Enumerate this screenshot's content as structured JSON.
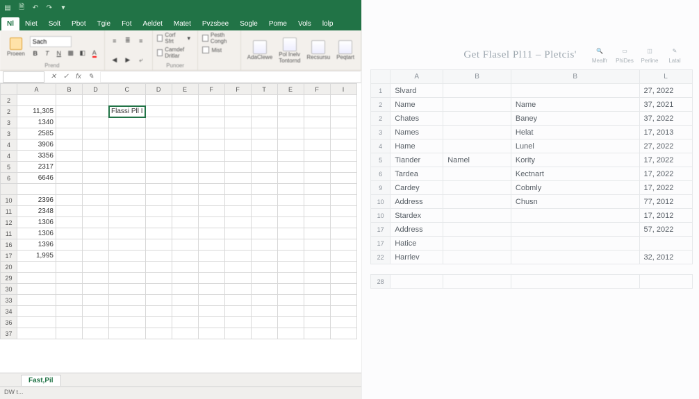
{
  "left": {
    "ribbon_tabs": [
      "Nl",
      "Niet",
      "Solt",
      "Pbot",
      "Tgie",
      "Fot",
      "Aeldet",
      "Matet",
      "Pvzsbee",
      "Sogle",
      "Pome",
      "Vols",
      "lolp"
    ],
    "active_tab_index": 0,
    "paste_label": "Proeen",
    "font_name": "Sach",
    "groups": {
      "g1": "Prend",
      "g2": "Punoer"
    },
    "checks": {
      "c1": "Corf Sfrt",
      "c2": "Camdef Dritlar",
      "c3": "Mist",
      "c4": "Pesth Congh"
    },
    "ribbon_btns": [
      "AdaClewe",
      "Pol Inelv Tontornd",
      "Recsursu",
      "Peqtart"
    ],
    "namebox": "",
    "formula": "",
    "col_headers": [
      "A",
      "B",
      "D",
      "C",
      "D",
      "E",
      "F",
      "F",
      "T",
      "E",
      "F",
      "I"
    ],
    "rows": [
      {
        "n": "2",
        "a": "",
        "c": ""
      },
      {
        "n": "2",
        "a": "11,305",
        "c": "Flassi Pll I"
      },
      {
        "n": "3",
        "a": "1340",
        "c": ""
      },
      {
        "n": "3",
        "a": "2585",
        "c": ""
      },
      {
        "n": "4",
        "a": "3906",
        "c": ""
      },
      {
        "n": "4",
        "a": "3356",
        "c": ""
      },
      {
        "n": "5",
        "a": "2317",
        "c": ""
      },
      {
        "n": "6",
        "a": "6646",
        "c": ""
      },
      {
        "n": "",
        "a": "",
        "c": ""
      },
      {
        "n": "10",
        "a": "2396",
        "c": ""
      },
      {
        "n": "11",
        "a": "2348",
        "c": ""
      },
      {
        "n": "12",
        "a": "1306",
        "c": ""
      },
      {
        "n": "11",
        "a": "1306",
        "c": ""
      },
      {
        "n": "16",
        "a": "1396",
        "c": ""
      },
      {
        "n": "17",
        "a": "1,995",
        "c": ""
      },
      {
        "n": "20",
        "a": "",
        "c": ""
      },
      {
        "n": "29",
        "a": "",
        "c": ""
      },
      {
        "n": "30",
        "a": "",
        "c": ""
      },
      {
        "n": "33",
        "a": "",
        "c": ""
      },
      {
        "n": "34",
        "a": "",
        "c": ""
      },
      {
        "n": "36",
        "a": "",
        "c": ""
      },
      {
        "n": "37",
        "a": "",
        "c": ""
      }
    ],
    "sheet_tab": "Fast,Pil",
    "status": "DW t..."
  },
  "right": {
    "title": "Get Flasel Pl11 – Pletcis'",
    "tools": [
      "Mealfr",
      "PhiDes",
      "Perline",
      "Latal"
    ],
    "col_headers": [
      "A",
      "B",
      "B",
      "L"
    ],
    "rows": [
      {
        "n": "1",
        "a": "Slvard",
        "b1": "",
        "b2": "",
        "l": "27, 2022"
      },
      {
        "n": "2",
        "a": "Name",
        "b1": "",
        "b2": "Name",
        "l": "37, 2021"
      },
      {
        "n": "2",
        "a": "Chates",
        "b1": "",
        "b2": "Baney",
        "l": "37, 2022"
      },
      {
        "n": "3",
        "a": "Names",
        "b1": "",
        "b2": "Helat",
        "l": "17, 2013"
      },
      {
        "n": "4",
        "a": "Hame",
        "b1": "",
        "b2": "Lunel",
        "l": "27, 2022"
      },
      {
        "n": "5",
        "a": "Tiander",
        "b1": "Namel",
        "b2": "Kority",
        "l": "17, 2022"
      },
      {
        "n": "6",
        "a": "Tardea",
        "b1": "",
        "b2": "Kectnart",
        "l": "17, 2022"
      },
      {
        "n": "9",
        "a": "Cardey",
        "b1": "",
        "b2": "Cobmly",
        "l": "17, 2022"
      },
      {
        "n": "10",
        "a": "Address",
        "b1": "",
        "b2": "Chusn",
        "l": "77, 2012"
      },
      {
        "n": "10",
        "a": "Stardex",
        "b1": "",
        "b2": "",
        "l": "17, 2012"
      },
      {
        "n": "17",
        "a": "Address",
        "b1": "",
        "b2": "",
        "l": "57, 2022"
      },
      {
        "n": "17",
        "a": "Hatice",
        "b1": "",
        "b2": "",
        "l": ""
      },
      {
        "n": "22",
        "a": "Harrlev",
        "b1": "",
        "b2": "",
        "l": "32, 2012"
      }
    ],
    "footer_row": "28"
  }
}
